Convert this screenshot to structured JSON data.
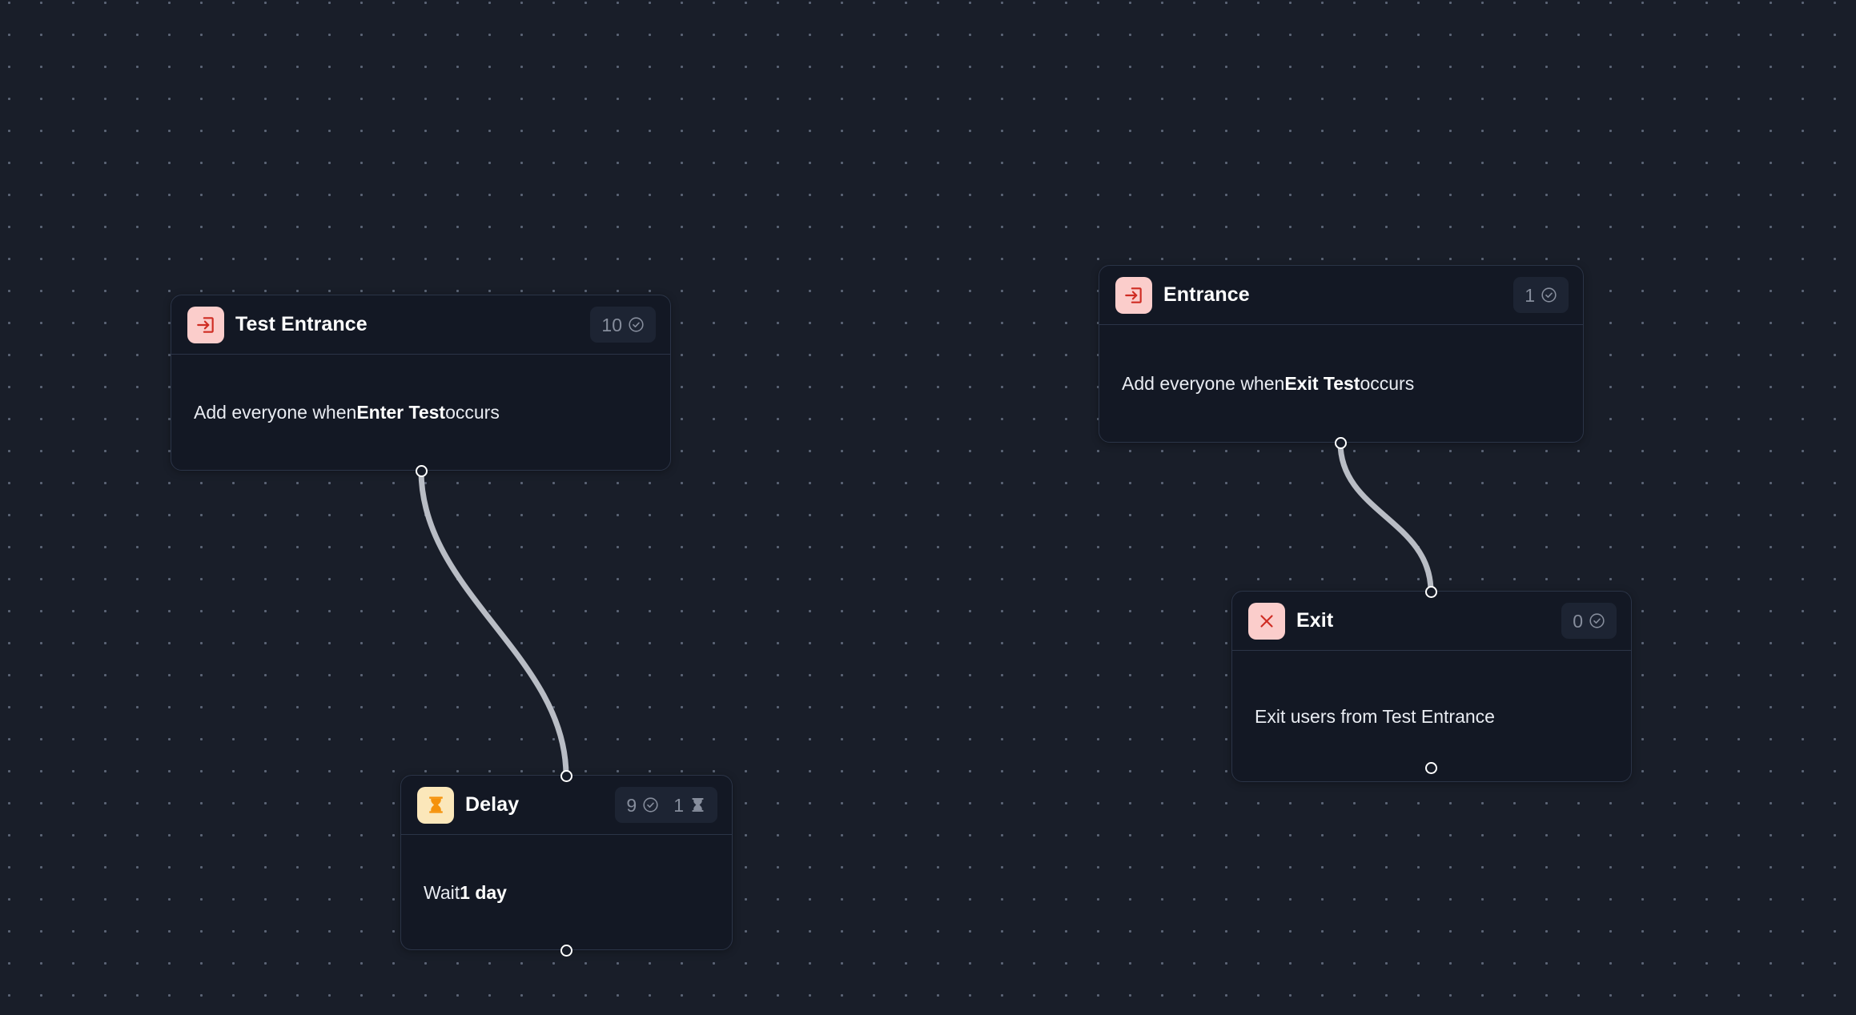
{
  "canvas": {
    "background_color": "#191e29",
    "dot_color": "#5b6475",
    "edge_color": "#b9bdc5"
  },
  "nodes": [
    {
      "id": "test-entrance",
      "title": "Test Entrance",
      "icon": "enter-arrow-icon",
      "icon_bg": "#fbcdcb",
      "icon_fg": "#cf2c23",
      "badges": [
        {
          "value": "10",
          "icon": "check-circle-icon"
        }
      ],
      "body_prefix": "Add everyone when ",
      "body_strong": "Enter Test",
      "body_suffix": " occurs"
    },
    {
      "id": "entrance",
      "title": "Entrance",
      "icon": "enter-arrow-icon",
      "icon_bg": "#fbcdcb",
      "icon_fg": "#cf2c23",
      "badges": [
        {
          "value": "1",
          "icon": "check-circle-icon"
        }
      ],
      "body_prefix": "Add everyone when ",
      "body_strong": "Exit Test",
      "body_suffix": " occurs"
    },
    {
      "id": "exit",
      "title": "Exit",
      "icon": "close-x-icon",
      "icon_bg": "#fbcdcb",
      "icon_fg": "#cf2c23",
      "badges": [
        {
          "value": "0",
          "icon": "check-circle-icon"
        }
      ],
      "body_prefix": "Exit users from Test Entrance",
      "body_strong": "",
      "body_suffix": ""
    },
    {
      "id": "delay",
      "title": "Delay",
      "icon": "hourglass-icon",
      "icon_bg": "#fbe7ba",
      "icon_fg": "#f5920b",
      "badges": [
        {
          "value": "9",
          "icon": "check-circle-icon"
        },
        {
          "value": "1",
          "icon": "hourglass-icon"
        }
      ],
      "body_prefix": "Wait ",
      "body_strong": "1 day",
      "body_suffix": ""
    }
  ],
  "edges": [
    {
      "id": "test-entrance-to-delay",
      "from": "test-entrance",
      "to": "delay"
    },
    {
      "id": "entrance-to-exit",
      "from": "entrance",
      "to": "exit"
    }
  ]
}
